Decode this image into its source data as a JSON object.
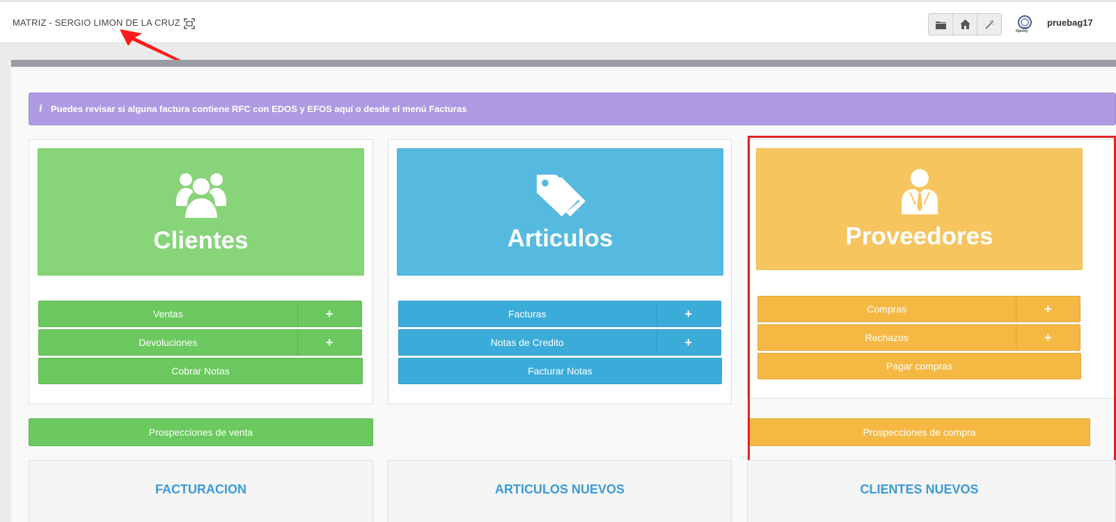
{
  "header": {
    "company": "MATRIZ - SERGIO LIMON DE LA CRUZ",
    "logo_text": "Oprovy",
    "username": "pruebag17"
  },
  "alert": {
    "icon": "i",
    "text": "Puedes revisar si alguna factura contiene RFC con EDOS y EFOS aquí o desde el menú Facturas"
  },
  "colors": {
    "green": "#6bc95f",
    "green_tile": "#88d479",
    "blue": "#3bacd9",
    "blue_tile": "#56b9e0",
    "yellow": "#f5b843",
    "yellow_tile": "#f7c55f",
    "alert": "#ae9be3",
    "highlight": "#e02020"
  },
  "cards": {
    "clientes": {
      "title": "Clientes",
      "icon": "users-icon",
      "rows": [
        {
          "label": "Ventas",
          "plus": "+"
        },
        {
          "label": "Devoluciones",
          "plus": "+"
        },
        {
          "label": "Cobrar Notas"
        }
      ],
      "prospect": "Prospecciones de venta"
    },
    "articulos": {
      "title": "Articulos",
      "icon": "tags-icon",
      "rows": [
        {
          "label": "Facturas",
          "plus": "+"
        },
        {
          "label": "Notas de Credito",
          "plus": "+"
        },
        {
          "label": "Facturar Notas"
        }
      ]
    },
    "proveedores": {
      "title": "Proveedores",
      "icon": "businessman-icon",
      "rows": [
        {
          "label": "Compras",
          "plus": "+"
        },
        {
          "label": "Rechazos",
          "plus": "+"
        },
        {
          "label": "Pagar compras"
        }
      ],
      "prospect": "Prospecciones de compra"
    }
  },
  "sections": {
    "facturacion": "FACTURACION",
    "articulos_nuevos": "ARTICULOS NUEVOS",
    "clientes_nuevos": "CLIENTES NUEVOS"
  }
}
